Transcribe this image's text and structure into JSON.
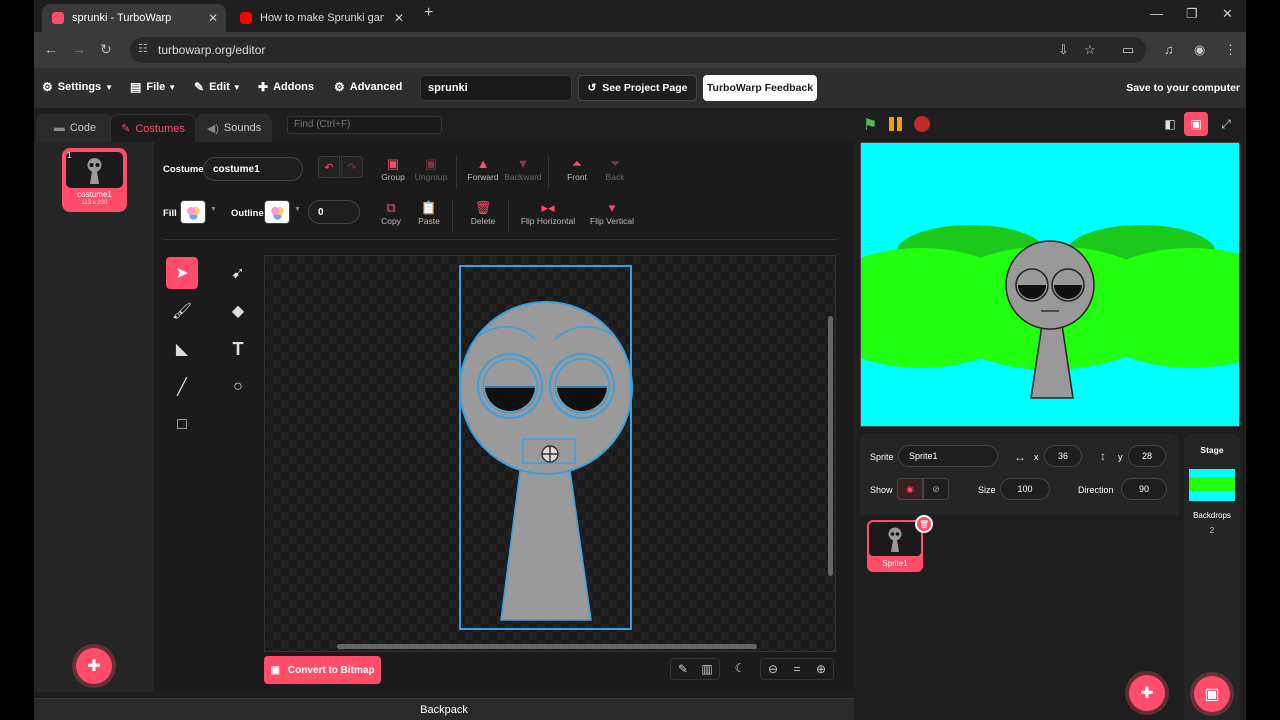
{
  "browser": {
    "tabs": [
      {
        "title": "sprunki - TurboWarp",
        "active": true
      },
      {
        "title": "How to make Sprunki game in S",
        "active": false
      }
    ],
    "url": "turbowarp.org/editor"
  },
  "menubar": {
    "settings": "Settings",
    "file": "File",
    "edit": "Edit",
    "addons": "Addons",
    "advanced": "Advanced",
    "project_title": "sprunki",
    "see_project_page": "See Project Page",
    "feedback": "TurboWarp Feedback",
    "save": "Save to your computer"
  },
  "editor_tabs": {
    "code": "Code",
    "costumes": "Costumes",
    "sounds": "Sounds",
    "find_placeholder": "Find (Ctrl+F)"
  },
  "costumes": [
    {
      "number": "1",
      "name": "costume1",
      "size": "113 x 230"
    }
  ],
  "paint": {
    "costume_label": "Costume",
    "costume_name": "costume1",
    "fill_label": "Fill",
    "outline_label": "Outline",
    "outline_width": "0",
    "buttons": {
      "group": "Group",
      "ungroup": "Ungroup",
      "forward": "Forward",
      "backward": "Backward",
      "front": "Front",
      "back": "Back",
      "copy": "Copy",
      "paste": "Paste",
      "delete": "Delete",
      "flip_horizontal": "Flip Horizontal",
      "flip_vertical": "Flip Vertical"
    },
    "convert": "Convert to Bitmap"
  },
  "sprite_info": {
    "sprite_label": "Sprite",
    "sprite_name": "Sprite1",
    "x_label": "x",
    "x": "36",
    "y_label": "y",
    "y": "28",
    "show_label": "Show",
    "size_label": "Size",
    "size": "100",
    "direction_label": "Direction",
    "direction": "90"
  },
  "sprites": [
    {
      "name": "Sprite1"
    }
  ],
  "stage_pane": {
    "title": "Stage",
    "backdrops_label": "Backdrops",
    "backdrops_count": "2"
  },
  "backpack": "Backpack",
  "colors": {
    "accent": "#ff4d6a",
    "stage_sky": "#00ffff",
    "stage_bush": "#22ff11",
    "character_gray": "#999999",
    "selection_blue": "#3aa0e0"
  }
}
